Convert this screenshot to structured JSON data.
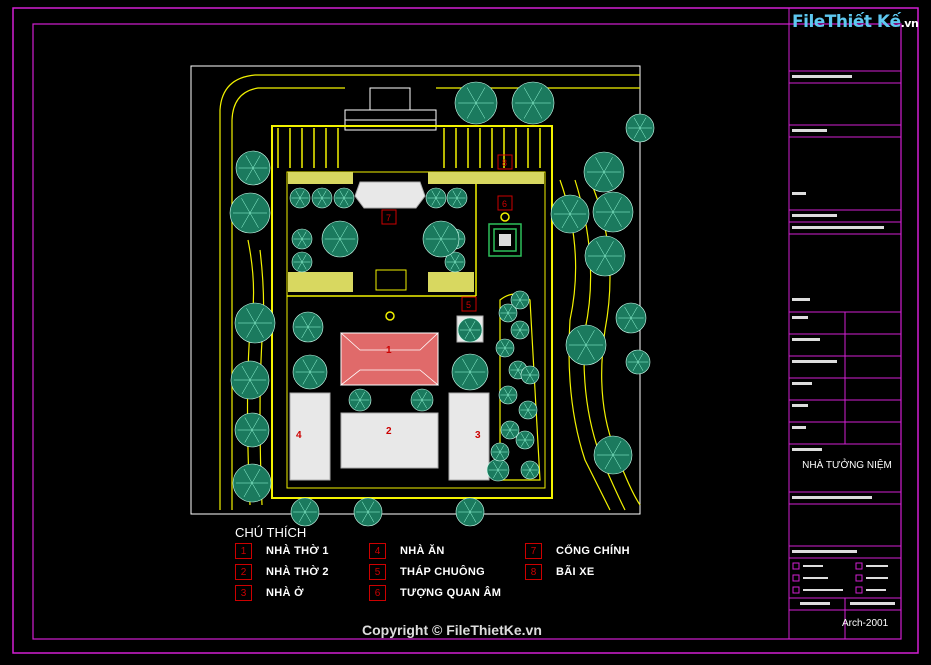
{
  "logo": {
    "text": "FileThiết Kế",
    "suffix": ".vn"
  },
  "legend": {
    "title": "CHÚ THÍCH",
    "items": [
      {
        "num": "1",
        "label": "NHÀ THỜ 1"
      },
      {
        "num": "2",
        "label": "NHÀ THỜ 2"
      },
      {
        "num": "3",
        "label": "NHÀ Ở"
      },
      {
        "num": "4",
        "label": "NHÀ ĂN"
      },
      {
        "num": "5",
        "label": "THÁP CHUÔNG"
      },
      {
        "num": "6",
        "label": "TƯỢNG QUAN ÂM"
      },
      {
        "num": "7",
        "label": "CỔNG CHÍNH"
      },
      {
        "num": "8",
        "label": "BÃI XE"
      }
    ]
  },
  "building_numbers": [
    "1",
    "2",
    "3",
    "4",
    "5",
    "6",
    "7",
    "8"
  ],
  "title_block": {
    "project_name": "NHÀ TƯỞNG NIỆM",
    "drawing_no": "Arch-2001"
  },
  "copyright": "Copyright © FileThietKe.vn",
  "colors": {
    "frame": "#d21fd2",
    "site_lines": "#f2f200",
    "tree": "#1b7a5e",
    "roof_red": "#e06a6a",
    "roof_white": "#e8e8e8",
    "label_red": "#cc0000"
  }
}
